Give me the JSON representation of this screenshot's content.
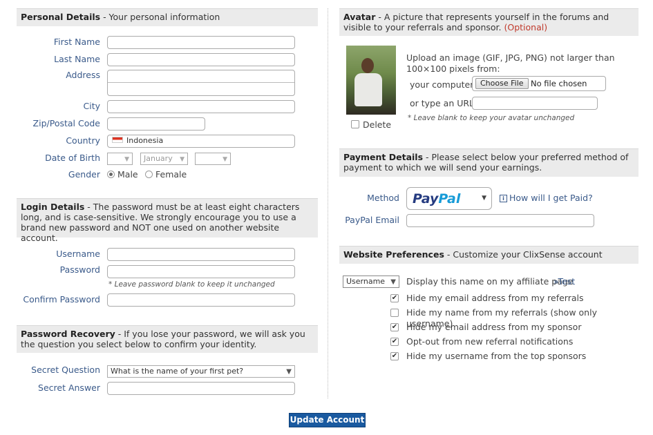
{
  "personal": {
    "title": "Personal Details",
    "subtitle": "- Your personal information",
    "first_name_label": "First Name",
    "last_name_label": "Last Name",
    "address_label": "Address",
    "city_label": "City",
    "zip_label": "Zip/Postal Code",
    "country_label": "Country",
    "country_value": "Indonesia",
    "dob_label": "Date of Birth",
    "dob_month": "January",
    "gender_label": "Gender",
    "gender_male": "Male",
    "gender_female": "Female"
  },
  "login": {
    "title": "Login Details",
    "subtitle": "- The password must be at least eight characters long, and is case-sensitive. We strongly encourage you to use a brand new password and NOT one used on another website account.",
    "username_label": "Username",
    "password_label": "Password",
    "password_note": "* Leave password blank to keep it unchanged",
    "confirm_label": "Confirm Password"
  },
  "recovery": {
    "title": "Password Recovery",
    "subtitle": "- If you lose your password, we will ask you the question you select below to confirm your identity.",
    "question_label": "Secret Question",
    "question_value": "What is the name of your first pet?",
    "answer_label": "Secret Answer"
  },
  "avatar": {
    "title": "Avatar",
    "subtitle": "- A picture that represents yourself in the forums and visible to your referrals and sponsor.",
    "optional": "(Optional)",
    "upload_text": "Upload an image (GIF, JPG, PNG) not larger than 100×100 pixels from:",
    "computer_label": "your computer",
    "choose_file": "Choose File",
    "no_file": "No file chosen",
    "url_label": "or type an URL",
    "url_note": "* Leave blank to keep your avatar unchanged",
    "delete_label": "Delete"
  },
  "payment": {
    "title": "Payment Details",
    "subtitle": "- Please select below your preferred method of payment to which we will send your earnings.",
    "method_label": "Method",
    "method_value_pay": "Pay",
    "method_value_pal": "Pal",
    "how_paid": "How will I get Paid?",
    "email_label": "PayPal Email"
  },
  "prefs": {
    "title": "Website Preferences",
    "subtitle": "- Customize your ClixSense account",
    "display_select": "Username",
    "display_text": "Display this name on my affiliate page",
    "test_link": "»Test",
    "options": [
      {
        "label": "Hide my email address from my referrals",
        "checked": true
      },
      {
        "label": "Hide my name from my referrals (show only username)",
        "checked": false
      },
      {
        "label": "Hide my email address from my sponsor",
        "checked": true
      },
      {
        "label": "Opt-out from new referral notifications",
        "checked": true
      },
      {
        "label": "Hide my username from the top sponsors",
        "checked": true
      }
    ]
  },
  "submit_label": "Update Account",
  "colors": {
    "accent": "#1a5aa0",
    "label": "#3a5a8a",
    "optional": "#c0392b"
  }
}
